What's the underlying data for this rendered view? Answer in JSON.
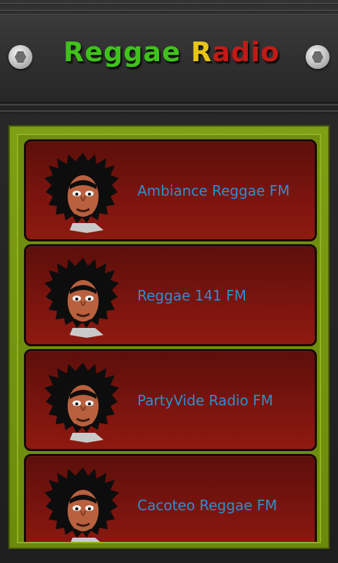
{
  "app": {
    "title_part1": "Reggae",
    "title_part2a": "R",
    "title_part2b": "adio"
  },
  "stations": [
    {
      "name": "Ambiance Reggae FM",
      "icon": "rasta-avatar-icon"
    },
    {
      "name": "Reggae 141 FM",
      "icon": "rasta-avatar-icon"
    },
    {
      "name": "PartyVide Radio FM",
      "icon": "rasta-avatar-icon"
    },
    {
      "name": "Cacoteo Reggae FM",
      "icon": "rasta-avatar-icon"
    }
  ],
  "colors": {
    "title_green": "#3fc21b",
    "title_yellow": "#e8c414",
    "title_red": "#c01b16",
    "frame_green": "#7f9f14",
    "row_red": "#7a140e",
    "label_blue": "#2d8fd0"
  }
}
